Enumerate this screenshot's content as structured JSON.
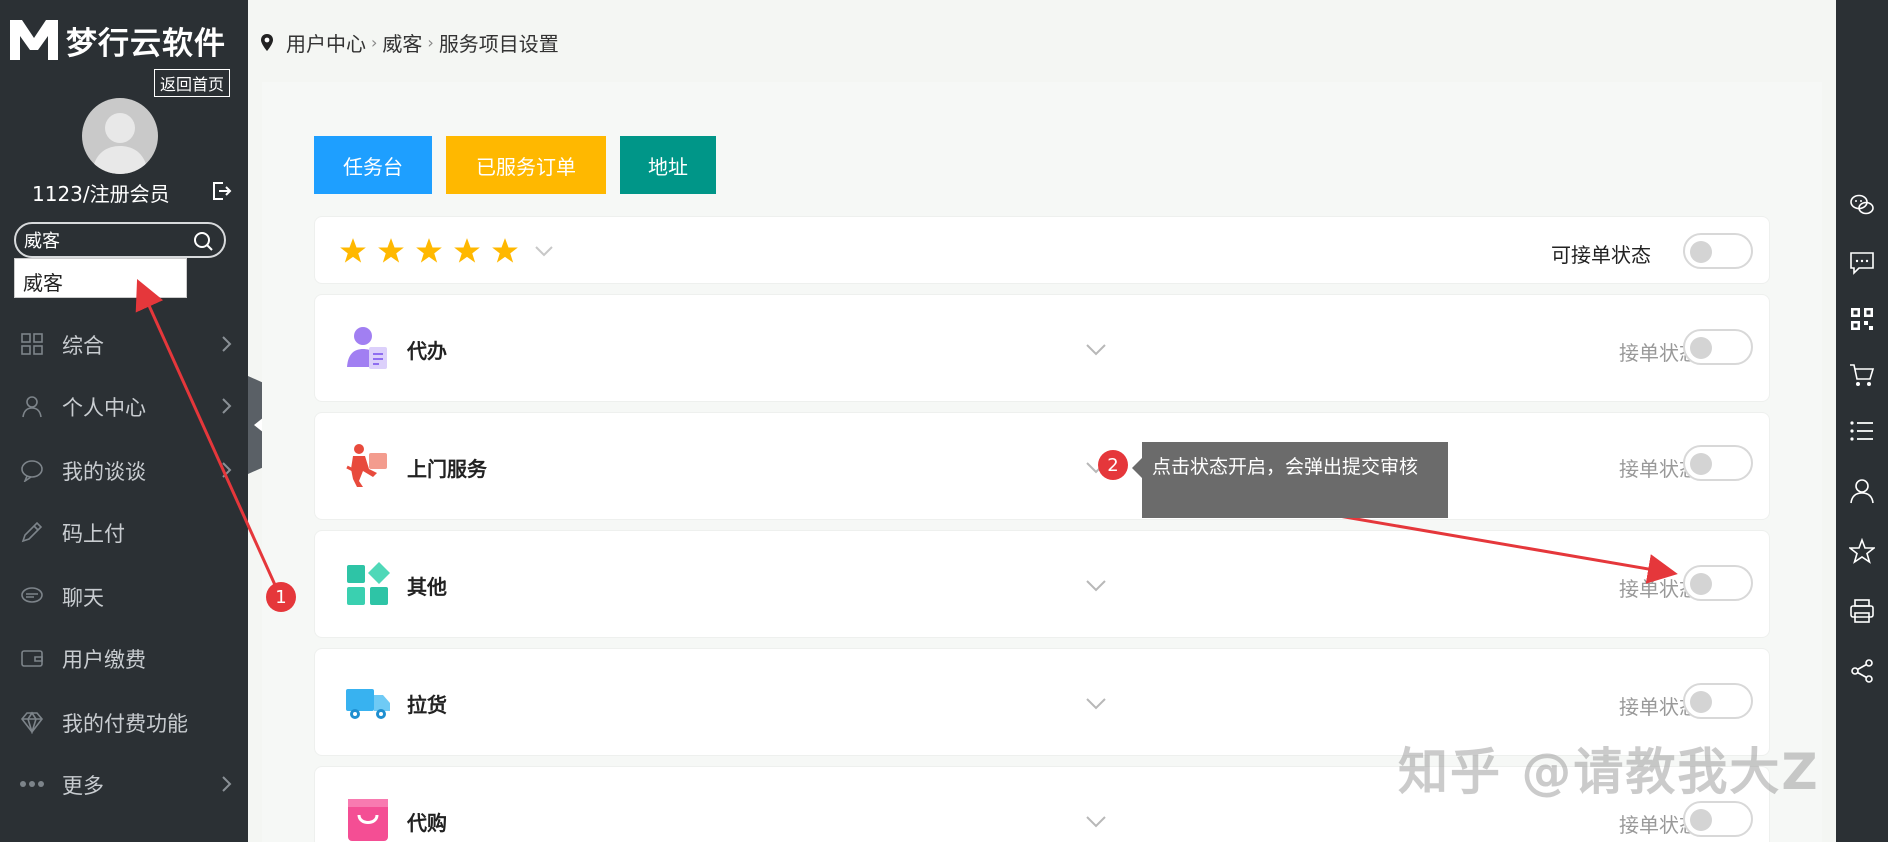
{
  "brand": {
    "name": "梦行云软件",
    "back_home": "返回首页"
  },
  "user": {
    "name": "1123/注册会员"
  },
  "search": {
    "value": "威客",
    "suggestion": "威客"
  },
  "sidebar": {
    "items": [
      {
        "label": "综合",
        "icon": "grid-icon",
        "has_chevron": true
      },
      {
        "label": "个人中心",
        "icon": "user-icon",
        "has_chevron": true
      },
      {
        "label": "我的谈谈",
        "icon": "chat-bubble-icon",
        "has_chevron": true
      },
      {
        "label": "码上付",
        "icon": "pencil-icon",
        "has_chevron": false
      },
      {
        "label": "聊天",
        "icon": "message-icon",
        "has_chevron": false
      },
      {
        "label": "用户缴费",
        "icon": "wallet-icon",
        "has_chevron": false
      },
      {
        "label": "我的付费功能",
        "icon": "diamond-icon",
        "has_chevron": false
      },
      {
        "label": "更多",
        "icon": "more-dots-icon",
        "has_chevron": true
      }
    ]
  },
  "breadcrumb": {
    "items": [
      "用户中心",
      "威客",
      "服务项目设置"
    ]
  },
  "tabs": [
    {
      "label": "任务台",
      "color": "#1e9fff"
    },
    {
      "label": "已服务订单",
      "color": "#ffb800"
    },
    {
      "label": "地址",
      "color": "#009688"
    }
  ],
  "rating": {
    "stars": 5,
    "status_label": "可接单状态",
    "enabled": false
  },
  "services": [
    {
      "name": "代办",
      "icon": "agent-person-icon",
      "status_label": "接单状态",
      "enabled": false
    },
    {
      "name": "上门服务",
      "icon": "delivery-runner-icon",
      "status_label": "接单状态",
      "enabled": false
    },
    {
      "name": "其他",
      "icon": "blocks-icon",
      "status_label": "接单状态",
      "enabled": false
    },
    {
      "name": "拉货",
      "icon": "truck-icon",
      "status_label": "接单状态",
      "enabled": false
    },
    {
      "name": "代购",
      "icon": "shopping-bag-icon",
      "status_label": "接单状态",
      "enabled": false
    }
  ],
  "annotations": {
    "badge1": "1",
    "badge2": "2",
    "tooltip": "点击状态开启，会弹出提交审核"
  },
  "watermark": "知乎 @请教我大Z",
  "rightbar_icons": [
    "wechat-icon",
    "comment-icon",
    "qrcode-icon",
    "cart-icon",
    "list-icon",
    "person-icon",
    "star-icon",
    "print-icon",
    "share-icon"
  ],
  "colors": {
    "sidebar_bg": "#2b3034",
    "accent_blue": "#1e9fff",
    "accent_yellow": "#ffb800",
    "accent_teal": "#009688",
    "badge_red": "#e5373b"
  }
}
